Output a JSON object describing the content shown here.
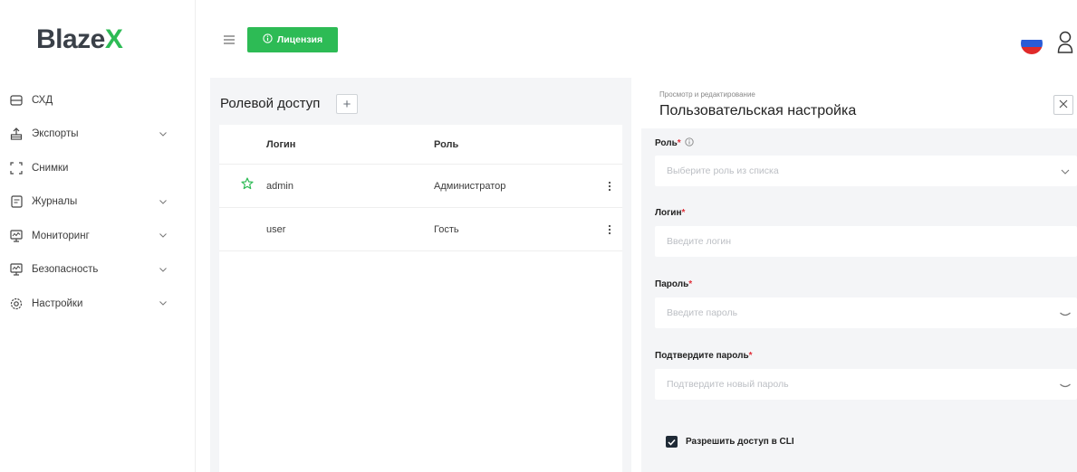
{
  "app": {
    "logo_part1": "Blaze",
    "logo_part2": "X",
    "brand_color": "#2dbb55"
  },
  "topbar": {
    "license_label": "Лицензия",
    "language_flag": "ru-flag-icon",
    "user_icon": "user-icon"
  },
  "sidebar": {
    "items": [
      {
        "label": "СХД",
        "icon": "storage-icon",
        "has_submenu": false
      },
      {
        "label": "Экспорты",
        "icon": "export-icon",
        "has_submenu": true
      },
      {
        "label": "Снимки",
        "icon": "snapshot-icon",
        "has_submenu": false
      },
      {
        "label": "Журналы",
        "icon": "journal-icon",
        "has_submenu": true
      },
      {
        "label": "Мониторинг",
        "icon": "monitor-icon",
        "has_submenu": true
      },
      {
        "label": "Безопасность",
        "icon": "security-icon",
        "has_submenu": true
      },
      {
        "label": "Настройки",
        "icon": "settings-icon",
        "has_submenu": true
      }
    ]
  },
  "role_access": {
    "title": "Ролевой доступ",
    "add_label": "+",
    "columns": {
      "login": "Логин",
      "role": "Роль"
    },
    "rows": [
      {
        "login": "admin",
        "role": "Администратор",
        "starred": true
      },
      {
        "login": "user",
        "role": "Гость",
        "starred": false
      }
    ]
  },
  "editor": {
    "subtitle": "Просмотр и редактирование",
    "title": "Пользовательская настройка",
    "fields": {
      "role": {
        "label": "Роль",
        "placeholder": "Выберите роль из списка"
      },
      "login": {
        "label": "Логин",
        "placeholder": "Введите логин"
      },
      "password": {
        "label": "Пароль",
        "placeholder": "Введите пароль"
      },
      "confirm": {
        "label": "Подтвердите пароль",
        "placeholder": "Подтвердите новый пароль"
      }
    },
    "cli": {
      "label": "Разрешить доступ в CLI",
      "checked": true
    }
  }
}
